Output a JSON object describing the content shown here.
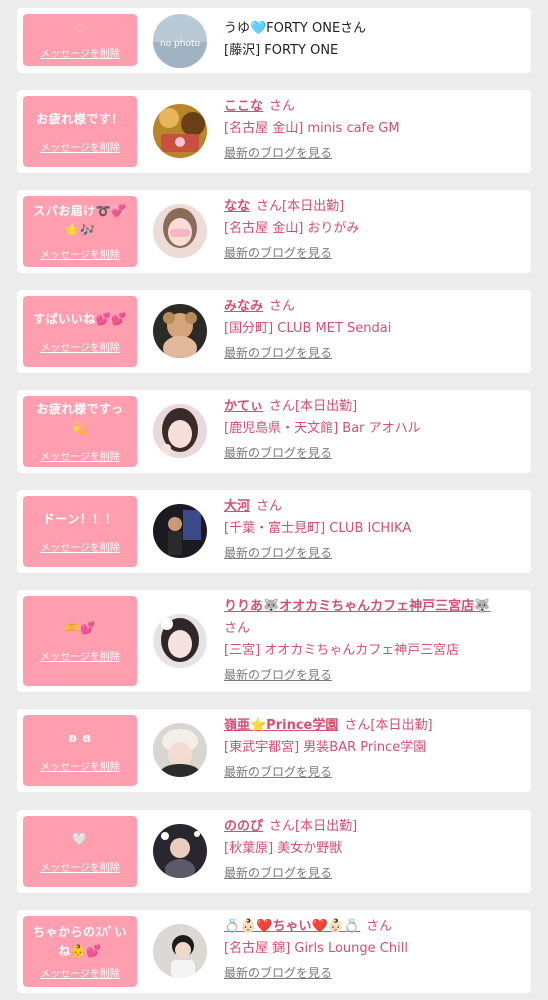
{
  "ui": {
    "delete_label": "メッセージを削除",
    "blog_label": "最新のブログを見る"
  },
  "items": [
    {
      "message": "♡",
      "name": "うゆ🩵FORTY ONEさん",
      "san": "",
      "shop": "[藤沢] FORTY ONE"
    },
    {
      "message": "お疲れ様です！",
      "name": "ここな",
      "san": "さん",
      "shop": "[名古屋 金山] minis cafe GM"
    },
    {
      "message": "スパお届け➰💞⭐🎶",
      "name": "なな",
      "san": "さん[本日出勤]",
      "shop": "[名古屋 金山] おりがみ"
    },
    {
      "message": "すばいいね💕💕",
      "name": "みなみ",
      "san": "さん",
      "shop": "[国分町] CLUB MET Sendai"
    },
    {
      "message": "お疲れ様ですっ💫",
      "name": "かてぃ",
      "san": "さん[本日出勤]",
      "shop": "[鹿児島県・天文館] Bar アオハル"
    },
    {
      "message": "ドーン！！！",
      "name": "大河",
      "san": "さん",
      "shop": "[千葉・富士見町] CLUB ICHIKA"
    },
    {
      "message": "🫶💕",
      "name": "りりあ🐺オオカミちゃんカフェ神戸三宮店🐺",
      "san": "さん",
      "shop": "[三宮] オオカミちゃんカフェ神戸三宮店"
    },
    {
      "message": "ʚ ɞ",
      "name": "嶺亜⭐Prince学園",
      "san": "さん[本日出勤]",
      "shop": "[東武宇都宮] 男装BAR Prince学園"
    },
    {
      "message": "🤍",
      "name": "ののぴ",
      "san": "さん[本日出勤]",
      "shop": "[秋葉原] 美女か野獣"
    },
    {
      "message": "ちゃからのｽﾊﾟいね👶💕",
      "name": "💍👶🏻❤️ちゃい❤️👶🏻💍",
      "san": "さん",
      "shop": "[名古屋 錦] Girls Lounge Chill"
    }
  ]
}
